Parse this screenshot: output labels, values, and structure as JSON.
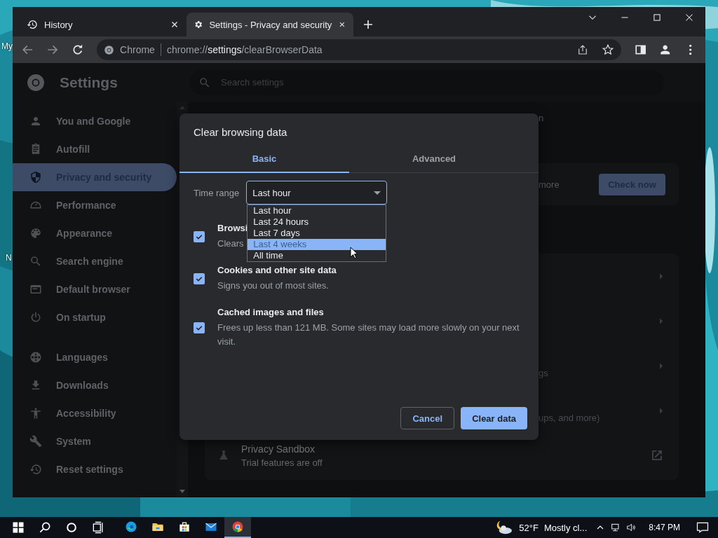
{
  "desktop": {
    "labels": [
      "My",
      "N"
    ]
  },
  "browser": {
    "tabs": [
      {
        "title": "History",
        "kind": "history",
        "selected": false
      },
      {
        "title": "Settings - Privacy and security",
        "kind": "gear",
        "selected": true
      }
    ],
    "address": {
      "site": "Chrome",
      "url": "chrome://**settings**/clearBrowserData"
    }
  },
  "settings": {
    "title": "Settings",
    "search_placeholder": "Search settings",
    "sidebar_groups": [
      [
        {
          "label": "You and Google",
          "kind": "person",
          "selected": false
        },
        {
          "label": "Autofill",
          "kind": "clipboard",
          "selected": false
        },
        {
          "label": "Privacy and security",
          "kind": "shield",
          "selected": true
        },
        {
          "label": "Performance",
          "kind": "gauge",
          "selected": false
        },
        {
          "label": "Appearance",
          "kind": "palette",
          "selected": false
        },
        {
          "label": "Search engine",
          "kind": "search",
          "selected": false
        },
        {
          "label": "Default browser",
          "kind": "browser",
          "selected": false
        },
        {
          "label": "On startup",
          "kind": "power",
          "selected": false
        }
      ],
      [
        {
          "label": "Languages",
          "kind": "globe",
          "selected": false
        },
        {
          "label": "Downloads",
          "kind": "download",
          "selected": false
        },
        {
          "label": "Accessibility",
          "kind": "accessibility",
          "selected": false
        },
        {
          "label": "System",
          "kind": "wrench",
          "selected": false
        },
        {
          "label": "Reset settings",
          "kind": "history",
          "selected": false
        }
      ]
    ],
    "heading_fragment": "n",
    "safety_check": {
      "text_fragment": "more",
      "button": "Check now"
    },
    "privacy_rows": [
      {
        "kind": "link"
      },
      {
        "kind": "link"
      },
      {
        "kind": "link",
        "subtitle_fragment": "gs"
      },
      {
        "kind": "link",
        "subtitle_fragment": "ups, and more)"
      },
      {
        "kind": "external",
        "title": "Privacy Sandbox",
        "subtitle": "Trial features are off"
      }
    ]
  },
  "dialog": {
    "title": "Clear browsing data",
    "tabs": [
      {
        "label": "Basic",
        "selected": true
      },
      {
        "label": "Advanced",
        "selected": false
      }
    ],
    "time_range": {
      "label": "Time range",
      "value": "Last hour",
      "expanded": true,
      "options": [
        {
          "label": "Last hour",
          "highlighted": false
        },
        {
          "label": "Last 24 hours",
          "highlighted": false
        },
        {
          "label": "Last 7 days",
          "highlighted": false
        },
        {
          "label": "Last 4 weeks",
          "highlighted": true
        },
        {
          "label": "All time",
          "highlighted": false
        }
      ]
    },
    "items": [
      {
        "title": "Browsi",
        "description": "Clears",
        "checked": true
      },
      {
        "title": "Cookies and other site data",
        "description": "Signs you out of most sites.",
        "checked": true
      },
      {
        "title": "Cached images and files",
        "description": "Frees up less than 121 MB. Some sites may load more slowly on your next visit.",
        "checked": true
      }
    ],
    "buttons": [
      {
        "label": "Cancel",
        "kind": "secondary"
      },
      {
        "label": "Clear data",
        "kind": "primary"
      }
    ]
  },
  "taskbar": {
    "apps": [
      {
        "kind": "edge",
        "selected": false
      },
      {
        "kind": "folder",
        "selected": false
      },
      {
        "kind": "store",
        "selected": false
      },
      {
        "kind": "mail",
        "selected": false
      },
      {
        "kind": "chrome",
        "selected": true
      }
    ],
    "temperature": "52°F",
    "weather": "Mostly cl...",
    "time": "8:47 PM"
  }
}
